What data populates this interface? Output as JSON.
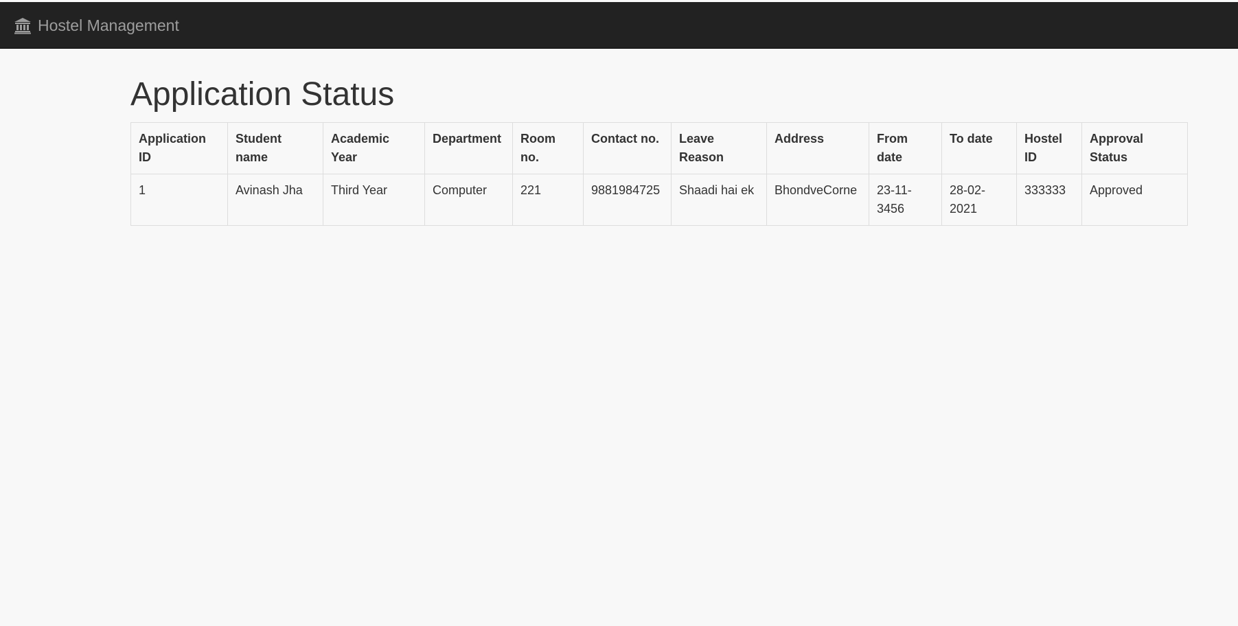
{
  "navbar": {
    "brand_icon": "bank-building-icon",
    "brand_label": "Hostel Management"
  },
  "page": {
    "title": "Application Status"
  },
  "table": {
    "headers": [
      "Application ID",
      "Student name",
      "Academic Year",
      "Department",
      "Room no.",
      "Contact no.",
      "Leave Reason",
      "Address",
      "From date",
      "To date",
      "Hostel ID",
      "Approval Status"
    ],
    "rows": [
      {
        "cells": [
          "1",
          "Avinash Jha",
          "Third Year",
          "Computer",
          "221",
          "9881984725",
          "Shaadi hai ek",
          "BhondveCorne",
          "23-11-3456",
          "28-02-2021",
          "333333",
          "Approved"
        ]
      }
    ]
  },
  "colors": {
    "navbar_bg": "#222222",
    "brand_text": "#9d9d9d",
    "page_bg": "#f8f8f8",
    "text": "#333333",
    "table_border": "#dddddd"
  }
}
